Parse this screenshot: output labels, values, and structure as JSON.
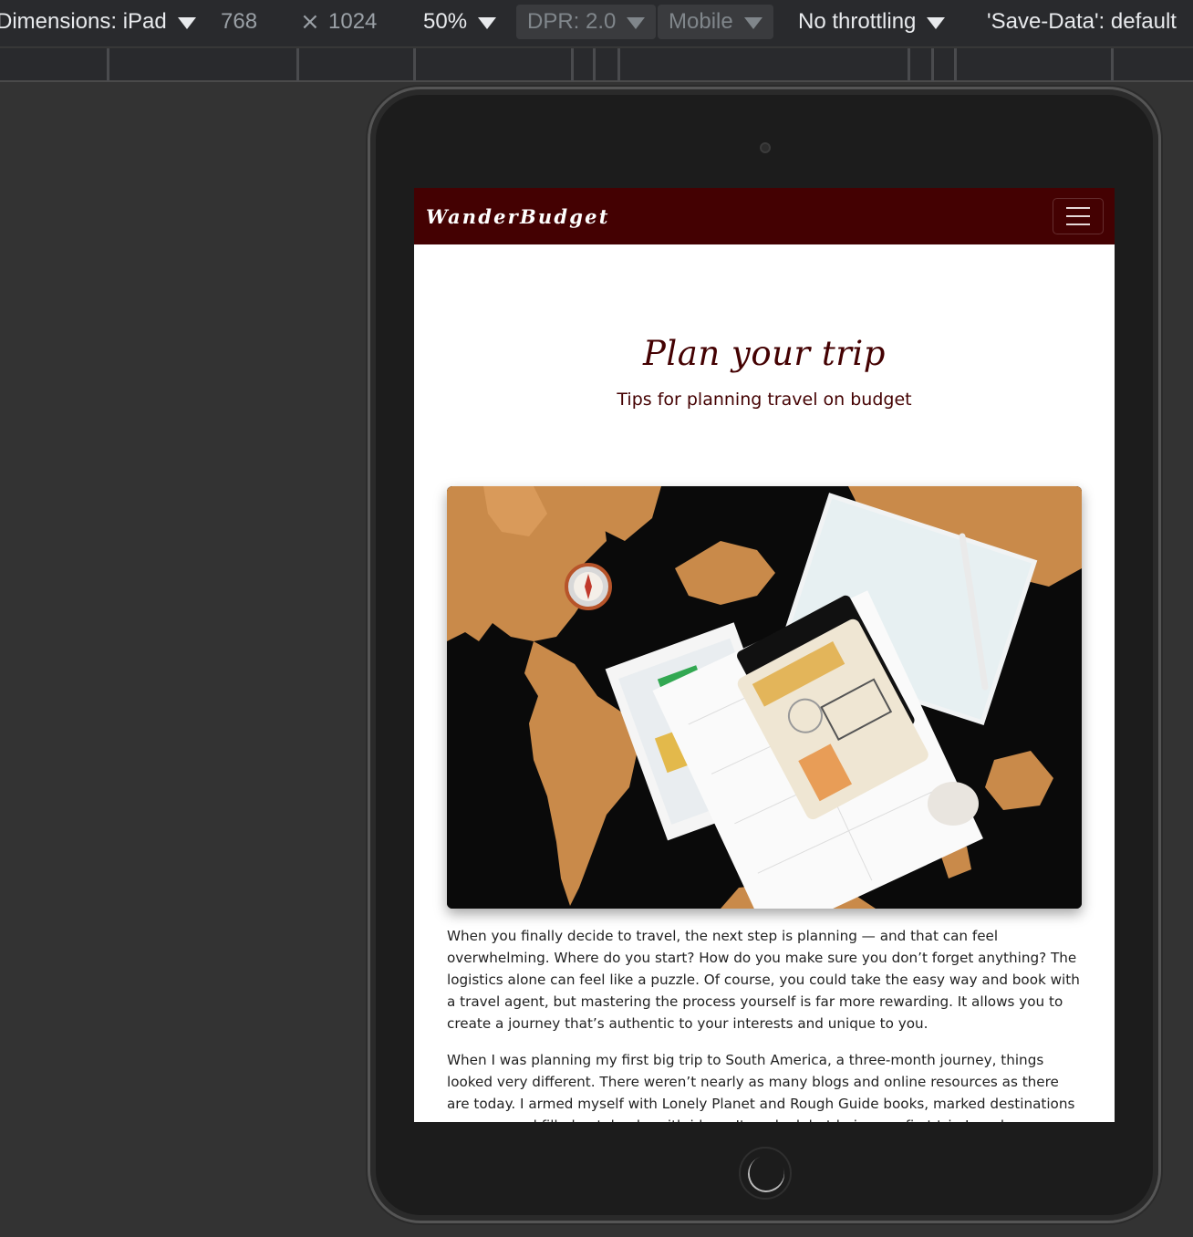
{
  "devtools": {
    "dimensions_label": "Dimensions: iPad",
    "width": "768",
    "times": "×",
    "height": "1024",
    "zoom": "50%",
    "dpr": "DPR: 2.0",
    "device_type": "Mobile",
    "throttling": "No throttling",
    "save_data": "'Save-Data': default"
  },
  "site": {
    "brand": "WanderBudget",
    "nav_toggle_icon": "hamburger-menu-icon",
    "nav_color": "#440102"
  },
  "hero": {
    "title": "Plan your trip",
    "subtitle": "Tips for planning travel on budget"
  },
  "article": {
    "paragraphs": [
      "When you finally decide to travel, the next step is planning — and that can feel overwhelming. Where do you start? How do you make sure you don’t forget anything? The logistics alone can feel like a puzzle. Of course, you could take the easy way and book with a travel agent, but mastering the process yourself is far more rewarding. It allows you to create a journey that’s authentic to your interests and unique to you.",
      "When I was planning my first big trip to South America, a three-month journey, things looked very different. There weren’t nearly as many blogs and online resources as there are today. I armed myself with Lonely Planet and Rough Guide books, marked destinations on maps and filled notebooks with ideas. It worked, but being my first trip I made mistakes."
    ]
  }
}
